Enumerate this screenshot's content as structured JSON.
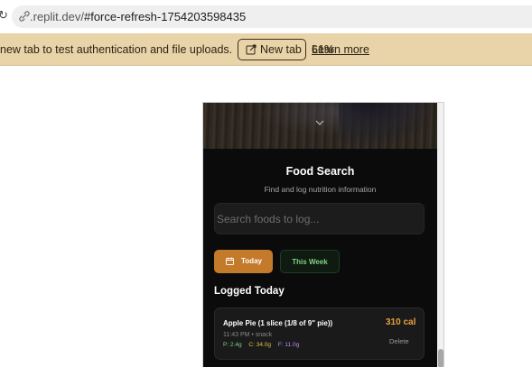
{
  "browser": {
    "url_prefix": ".replit.dev/",
    "url_path": "#force-refresh-1754203598435"
  },
  "banner": {
    "message": "new tab to test authentication and file uploads.",
    "new_tab_label": "New tab",
    "overlap_number": "61%",
    "learn_more_label": "Learn more"
  },
  "app": {
    "title": "Food Search",
    "subtitle": "Find and log nutrition information",
    "search_placeholder": "Search foods to log...",
    "buttons": {
      "today": "Today",
      "this_week": "This Week"
    },
    "section_title": "Logged Today",
    "entries": [
      {
        "name": "Apple Pie (1 slice (1/8 of 9\" pie))",
        "calories": "310 cal",
        "meta": "11:43 PM • snack",
        "protein": "P: 2.4g",
        "carbs": "C: 34.0g",
        "fat": "F: 11.0g",
        "delete_label": "Delete"
      }
    ]
  },
  "colors": {
    "banner_bg": "#e9d3a9",
    "accent_orange": "#c47a2b",
    "calorie_orange": "#e9a13d",
    "week_green": "#7ed488",
    "protein": "#7ed488",
    "carbs": "#e6c24a",
    "fat": "#b58cf0"
  }
}
